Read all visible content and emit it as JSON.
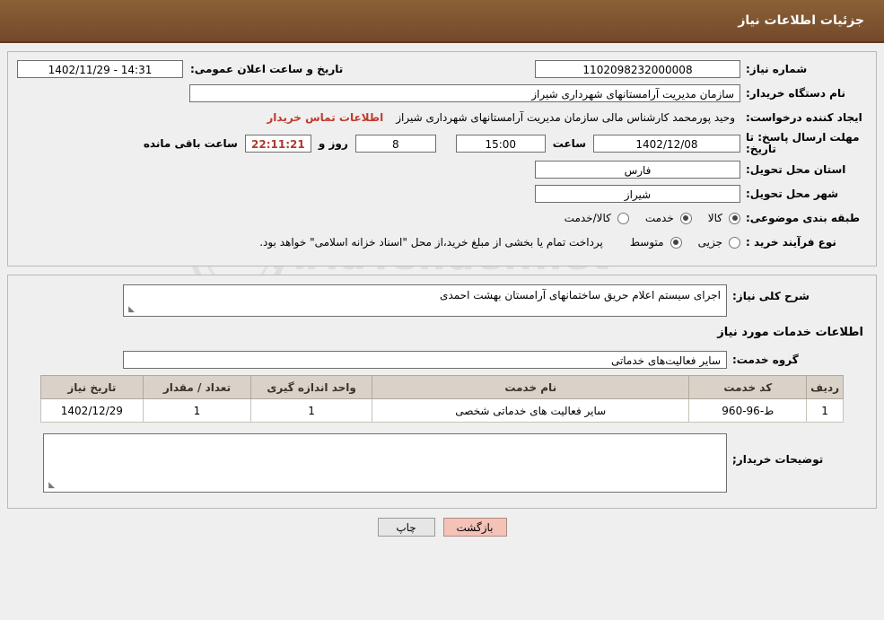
{
  "header": {
    "title": "جزئیات اطلاعات نیاز"
  },
  "top": {
    "need_number_label": "شماره نیاز:",
    "need_number_value": "1102098232000008",
    "announce_datetime_label": "تاریخ و ساعت اعلان عمومی:",
    "announce_datetime_value": "14:31 - 1402/11/29",
    "buyer_org_label": "نام دستگاه خریدار:",
    "buyer_org_value": "سازمان مدیریت آرامستانهای شهرداری شیراز",
    "requester_label": "ایجاد کننده درخواست:",
    "requester_value": "وحید پورمحمد کارشناس مالی سازمان مدیریت آرامستانهای شهرداری شیراز",
    "contact_link": "اطلاعات تماس خریدار",
    "deadline_label": "مهلت ارسال پاسخ: تا تاریخ:",
    "deadline_date": "1402/12/08",
    "hour_label": "ساعت",
    "deadline_time": "15:00",
    "days_value": "8",
    "days_label": "روز و",
    "countdown_value": "22:11:21",
    "remaining_label": "ساعت باقی مانده",
    "province_label": "استان محل تحویل:",
    "province_value": "فارس",
    "city_label": "شهر محل تحویل:",
    "city_value": "شیراز",
    "category_label": "طبقه بندی موضوعی:",
    "category_options": [
      {
        "label": "کالا",
        "selected": false
      },
      {
        "label": "خدمت",
        "selected": true
      },
      {
        "label": "کالا/خدمت",
        "selected": false
      }
    ],
    "purchase_type_label": "نوع فرآیند خرید :",
    "purchase_type_options": [
      {
        "label": "جزیی",
        "selected": false
      },
      {
        "label": "متوسط",
        "selected": true
      }
    ],
    "purchase_note": "پرداخت تمام یا بخشی از مبلغ خرید،از محل \"اسناد خزانه اسلامی\" خواهد بود."
  },
  "middle": {
    "general_desc_label": "شرح کلی نیاز:",
    "general_desc_value": "اجرای سیستم اعلام حریق ساختمانهای آرامستان بهشت احمدی",
    "services_info_title": "اطلاعات خدمات مورد نیاز",
    "service_group_label": "گروه خدمت:",
    "service_group_value": "سایر فعالیت‌های خدماتی",
    "table": {
      "columns": [
        "ردیف",
        "کد خدمت",
        "نام خدمت",
        "واحد اندازه گیری",
        "تعداد / مقدار",
        "تاریخ نیاز"
      ],
      "rows": [
        {
          "row": "1",
          "code": "ط-96-960",
          "name": "سایر فعالیت های خدماتی شخصی",
          "unit": "1",
          "quantity": "1",
          "date": "1402/12/29"
        }
      ]
    },
    "buyer_notes_label": "توضیحات خریدار;",
    "buyer_notes_value": ""
  },
  "footer": {
    "print_button": "چاپ",
    "back_button": "بازگشت"
  },
  "watermark": {
    "text": "AriaTender.net"
  }
}
